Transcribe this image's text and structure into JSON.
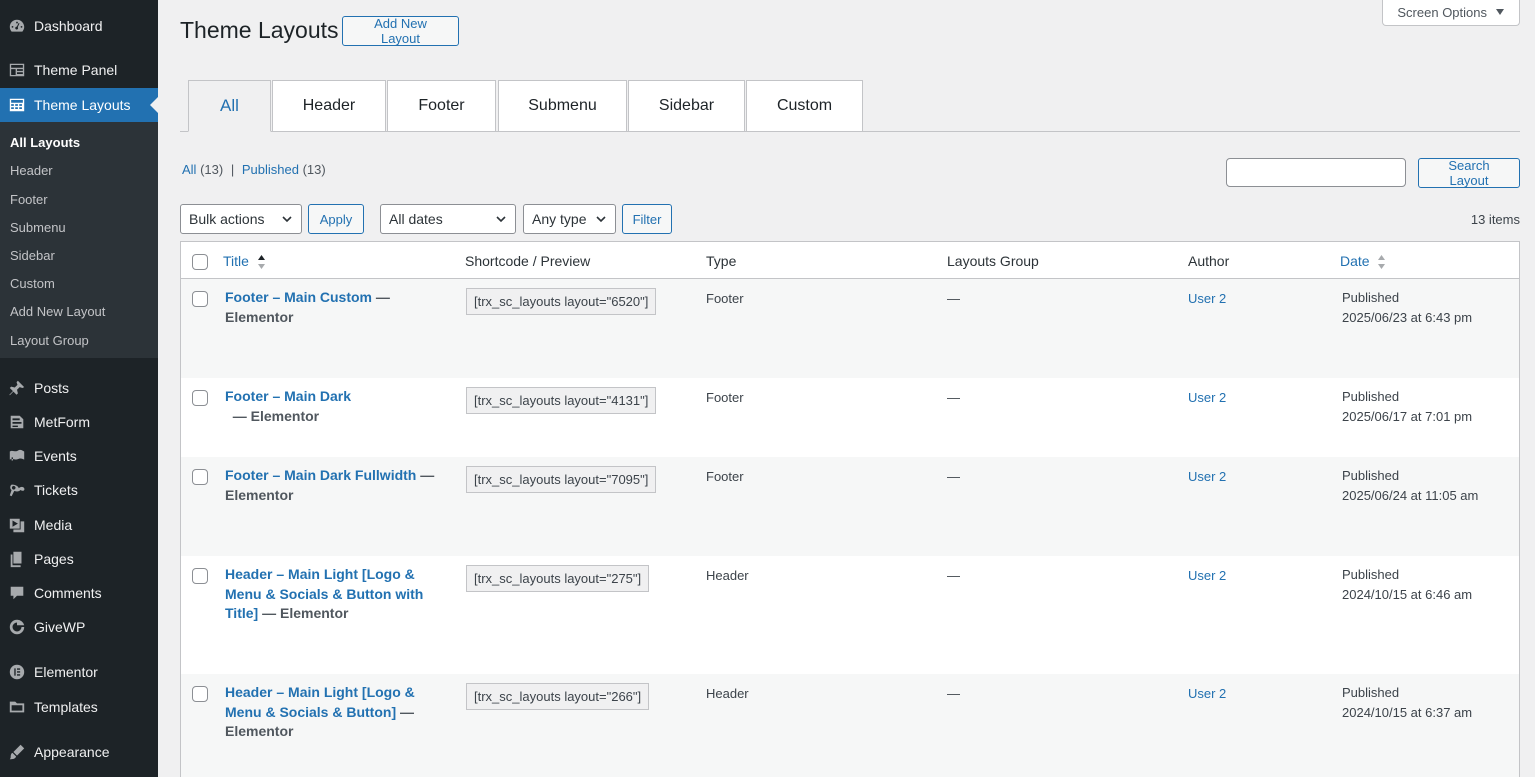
{
  "sidebar": {
    "menu": [
      {
        "label": "Dashboard",
        "icon": "dashboard-icon"
      },
      {
        "label": "Theme Panel",
        "icon": "theme-panel-icon"
      },
      {
        "label": "Theme Layouts",
        "icon": "theme-layouts-icon"
      },
      {
        "label": "Posts",
        "icon": "pin-icon"
      },
      {
        "label": "MetForm",
        "icon": "metform-icon"
      },
      {
        "label": "Events",
        "icon": "events-icon"
      },
      {
        "label": "Tickets",
        "icon": "tickets-icon"
      },
      {
        "label": "Media",
        "icon": "media-icon"
      },
      {
        "label": "Pages",
        "icon": "pages-icon"
      },
      {
        "label": "Comments",
        "icon": "comments-icon"
      },
      {
        "label": "GiveWP",
        "icon": "givewp-icon"
      },
      {
        "label": "Elementor",
        "icon": "elementor-icon"
      },
      {
        "label": "Templates",
        "icon": "folder-icon"
      },
      {
        "label": "Appearance",
        "icon": "brush-icon"
      }
    ],
    "submenu": [
      "All Layouts",
      "Header",
      "Footer",
      "Submenu",
      "Sidebar",
      "Custom",
      "Add New Layout",
      "Layout Group"
    ]
  },
  "header": {
    "title": "Theme Layouts",
    "add_new": "Add New Layout",
    "screen_options": "Screen Options"
  },
  "tabs": [
    "All",
    "Header",
    "Footer",
    "Submenu",
    "Sidebar",
    "Custom"
  ],
  "views": {
    "all": "All",
    "all_count": "(13)",
    "published": "Published",
    "published_count": "(13)",
    "separator": "|"
  },
  "search": {
    "button": "Search Layout",
    "value": ""
  },
  "filters": {
    "bulk_actions": "Bulk actions",
    "apply": "Apply",
    "dates": "All dates",
    "type": "Any type",
    "filter": "Filter",
    "items": "13 items"
  },
  "table": {
    "columns": [
      "Title",
      "Shortcode / Preview",
      "Type",
      "Layouts Group",
      "Author",
      "Date"
    ],
    "rows": [
      {
        "title": "Footer – Main Custom",
        "suffix": " — Elementor",
        "shortcode": "[trx_sc_layouts layout=\"6520\"]",
        "type": "Footer",
        "group": "—",
        "author": "User 2",
        "status": "Published",
        "date": "2025/06/23 at 6:43 pm"
      },
      {
        "title": "Footer – Main Dark",
        "suffix": "  — Elementor",
        "shortcode": "[trx_sc_layouts layout=\"4131\"]",
        "type": "Footer",
        "group": "—",
        "author": "User 2",
        "status": "Published",
        "date": "2025/06/17 at 7:01 pm"
      },
      {
        "title": "Footer – Main Dark Fullwidth",
        "suffix": " — Elementor",
        "shortcode": "[trx_sc_layouts layout=\"7095\"]",
        "type": "Footer",
        "group": "—",
        "author": "User 2",
        "status": "Published",
        "date": "2025/06/24 at 11:05 am"
      },
      {
        "title": "Header – Main Light [Logo & Menu & Socials & Button with Title]",
        "suffix": " — Elementor",
        "shortcode": "[trx_sc_layouts layout=\"275\"]",
        "type": "Header",
        "group": "—",
        "author": "User 2",
        "status": "Published",
        "date": "2024/10/15 at 6:46 am"
      },
      {
        "title": "Header – Main Light [Logo & Menu & Socials & Button]",
        "suffix": " — Elementor",
        "shortcode": "[trx_sc_layouts layout=\"266\"]",
        "type": "Header",
        "group": "—",
        "author": "User 2",
        "status": "Published",
        "date": "2024/10/15 at 6:37 am"
      }
    ]
  }
}
